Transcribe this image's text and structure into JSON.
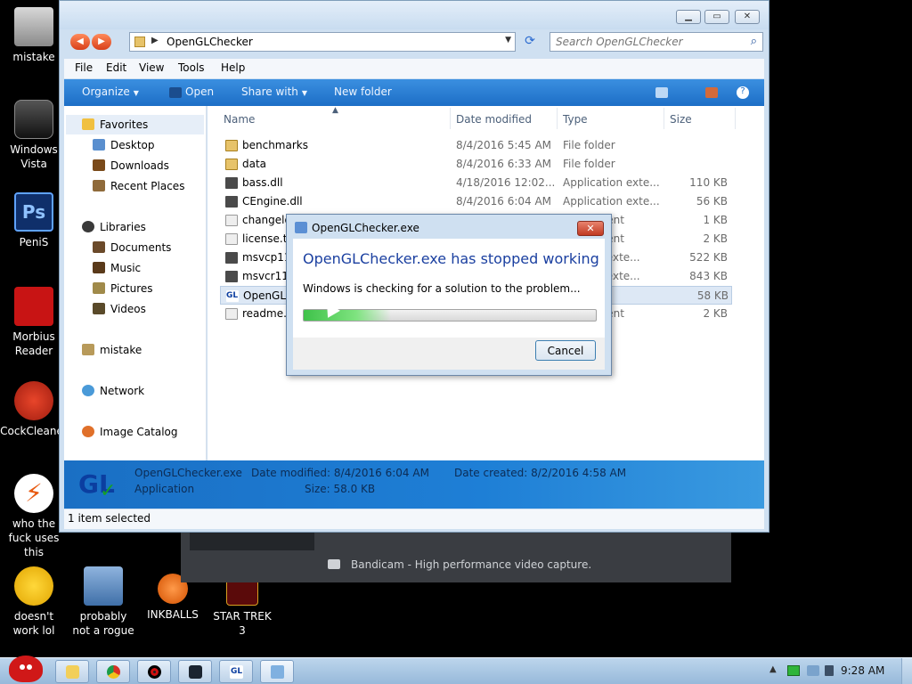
{
  "desktop": {
    "icons": [
      {
        "label": "mistake"
      },
      {
        "label": "Windows Vista"
      },
      {
        "label": "PeniS"
      },
      {
        "label": "Morbius Reader"
      },
      {
        "label": "CockCleaner"
      },
      {
        "label": "who the fuck uses this"
      },
      {
        "label": "doesn't work lol"
      },
      {
        "label": "probably not a rogue"
      },
      {
        "label": "INKBALLS"
      },
      {
        "label": "STAR TREK 3"
      }
    ]
  },
  "bandicam": {
    "text": "Bandicam - High performance video capture."
  },
  "explorer": {
    "address_path": "OpenGLChecker",
    "search_placeholder": "Search OpenGLChecker",
    "menus": [
      "File",
      "Edit",
      "View",
      "Tools",
      "Help"
    ],
    "toolbar": {
      "organize": "Organize",
      "open": "Open",
      "share_with": "Share with",
      "new_folder": "New folder"
    },
    "nav": {
      "favorites": "Favorites",
      "desktop": "Desktop",
      "downloads": "Downloads",
      "recent_places": "Recent Places",
      "libraries": "Libraries",
      "documents": "Documents",
      "music": "Music",
      "pictures": "Pictures",
      "videos": "Videos",
      "homegroup": "mistake",
      "network": "Network",
      "image_catalog": "Image Catalog"
    },
    "columns": {
      "name": "Name",
      "date": "Date modified",
      "type": "Type",
      "size": "Size"
    },
    "files": [
      {
        "name": "benchmarks",
        "date": "8/4/2016 5:45 AM",
        "type": "File folder",
        "size": ""
      },
      {
        "name": "data",
        "date": "8/4/2016 6:33 AM",
        "type": "File folder",
        "size": ""
      },
      {
        "name": "bass.dll",
        "date": "4/18/2016 12:02...",
        "type": "Application exte...",
        "size": "110 KB"
      },
      {
        "name": "CEngine.dll",
        "date": "8/4/2016 6:04 AM",
        "type": "Application exte...",
        "size": "56 KB"
      },
      {
        "name": "changelo",
        "date": "",
        "type": "ument",
        "size": "1 KB"
      },
      {
        "name": "license.t1",
        "date": "",
        "type": "ument",
        "size": "2 KB"
      },
      {
        "name": "msvcp11",
        "date": "",
        "type": "en exte...",
        "size": "522 KB"
      },
      {
        "name": "msvcr11",
        "date": "",
        "type": "en exte...",
        "size": "843 KB"
      },
      {
        "name": "OpenGL",
        "date": "",
        "type": "on",
        "size": "58 KB"
      },
      {
        "name": "readme.t",
        "date": "",
        "type": "ument",
        "size": "2 KB"
      }
    ],
    "details": {
      "filename": "OpenGLChecker.exe",
      "date_modified": "Date modified: 8/4/2016 6:04 AM",
      "date_created": "Date created: 8/2/2016 4:58 AM",
      "kind": "Application",
      "size": "Size: 58.0 KB"
    },
    "status": "1 item selected"
  },
  "dialog": {
    "title": "OpenGLChecker.exe",
    "heading": "OpenGLChecker.exe has stopped working",
    "message": "Windows is checking for a solution to the problem...",
    "progress": 0.3,
    "cancel": "Cancel"
  },
  "taskbar": {
    "clock": "9:28 AM"
  }
}
